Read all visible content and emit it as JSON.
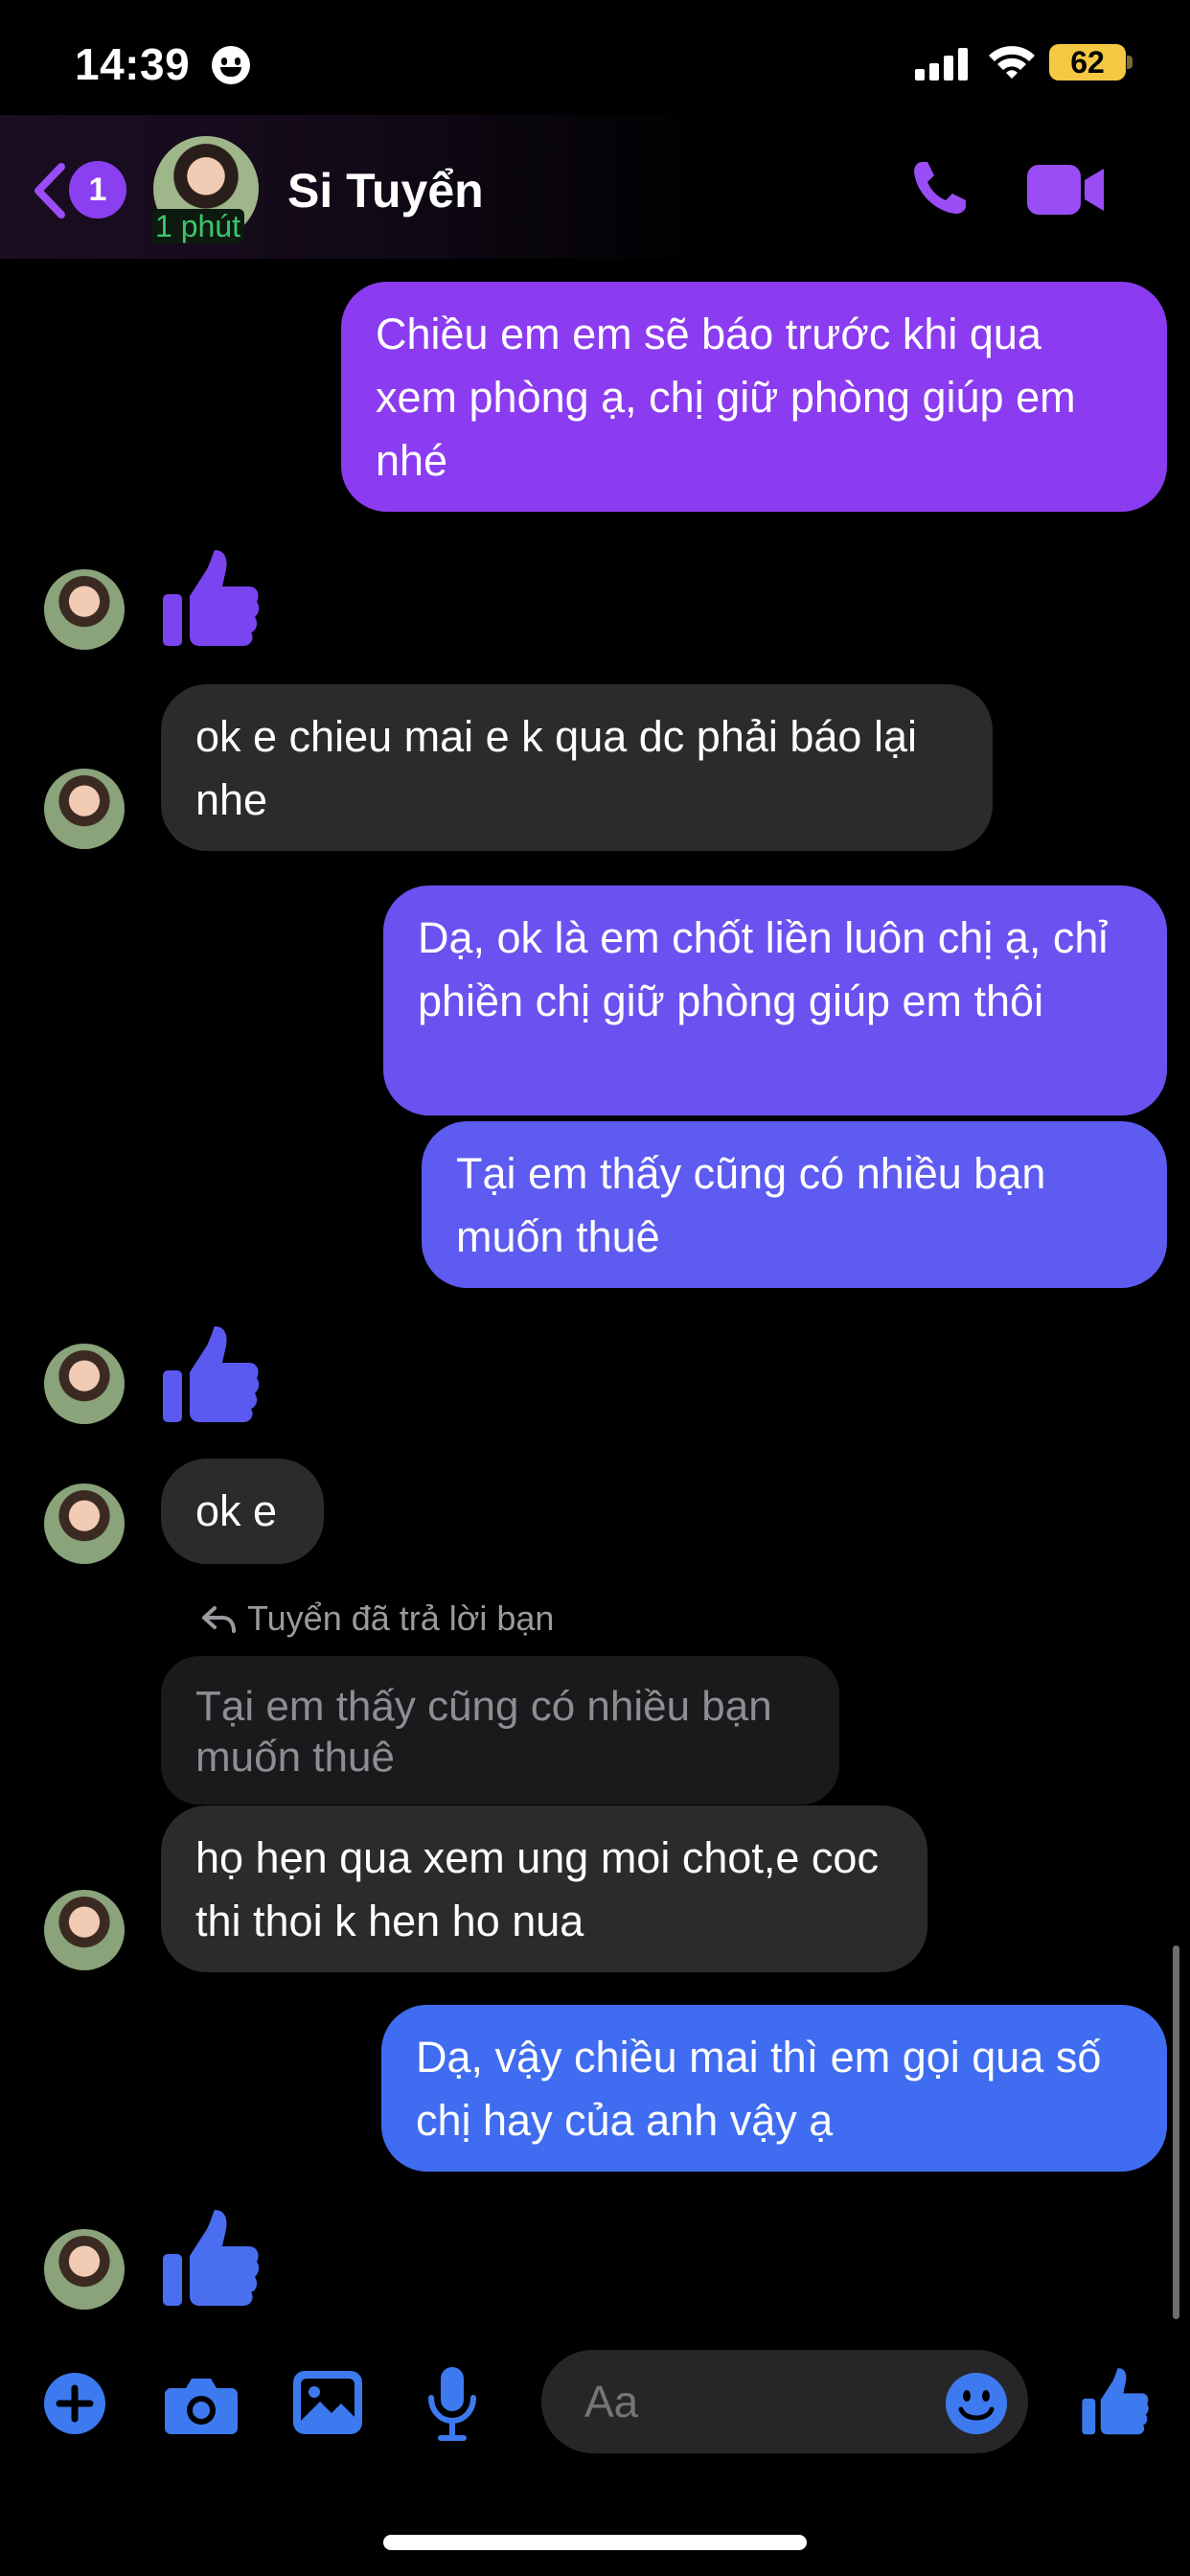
{
  "status_bar": {
    "time": "14:39",
    "battery": "62"
  },
  "header": {
    "back_badge": "1",
    "active_status": "1 phút",
    "contact_name": "Si Tuyển"
  },
  "messages": [
    {
      "id": "m1",
      "from": "me",
      "text": "Chiều em em sẽ báo trước khi qua xem phòng ạ, chị giữ phòng giúp em nhé"
    },
    {
      "id": "m2",
      "from": "them",
      "type": "like"
    },
    {
      "id": "m3",
      "from": "them",
      "text": "ok e chieu mai e k qua dc phải báo lại nhe"
    },
    {
      "id": "m4",
      "from": "me",
      "text": "Dạ, ok là em chốt liền luôn chị ạ, chỉ phiền chị giữ phòng giúp em thôi"
    },
    {
      "id": "m5",
      "from": "me",
      "text": "Tại em thấy cũng có nhiều bạn muốn thuê"
    },
    {
      "id": "m6",
      "from": "them",
      "type": "like"
    },
    {
      "id": "m7",
      "from": "them",
      "text": "ok e"
    },
    {
      "id": "m8",
      "from": "them",
      "reply_label": "Tuyển đã trả lời bạn",
      "quoted": "Tại em thấy cũng có nhiều bạn muốn thuê",
      "text": "họ hẹn qua xem ung moi chot,e coc thi thoi k hen ho nua"
    },
    {
      "id": "m9",
      "from": "me",
      "text": "Dạ, vậy chiều mai thì em gọi qua số chị hay của anh vậy ạ"
    },
    {
      "id": "m10",
      "from": "them",
      "type": "like"
    }
  ],
  "composer": {
    "placeholder": "Aa"
  },
  "colors": {
    "bubble_purple": "#8b3cf0",
    "bubble_indigo": "#6a52f0",
    "bubble_blue": "#3f6cf0",
    "incoming_bubble": "#2b2b2e",
    "accent_purple": "#9a4df5",
    "accent_blue": "#3d7af0",
    "like_purple": "#7a45f0",
    "like_blue": "#4a6ef0"
  },
  "icons": [
    "back-chevron-icon",
    "phone-icon",
    "video-icon",
    "thumbs-up-icon",
    "reply-arrow-icon",
    "plus-icon",
    "camera-icon",
    "gallery-icon",
    "mic-icon",
    "emoji-icon",
    "like-icon"
  ]
}
